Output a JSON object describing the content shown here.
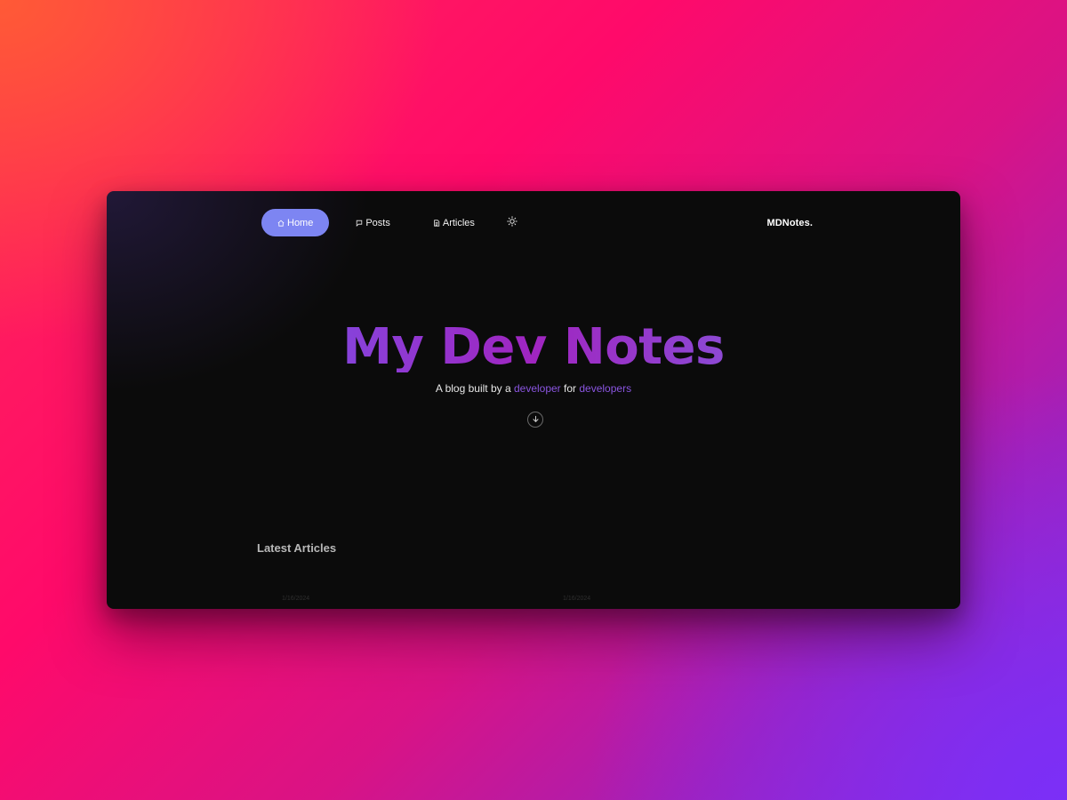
{
  "nav": {
    "items": [
      {
        "label": "Home",
        "icon": "home-icon",
        "active": true
      },
      {
        "label": "Posts",
        "icon": "chat-icon",
        "active": false
      },
      {
        "label": "Articles",
        "icon": "document-icon",
        "active": false
      }
    ],
    "theme_toggle_icon": "sun-icon",
    "brand": "MDNotes."
  },
  "hero": {
    "title": "My Dev Notes",
    "subtitle_parts": {
      "p1": "A blog built by a ",
      "p2": "developer",
      "p3": " for ",
      "p4": "developers"
    },
    "scroll_icon": "arrow-down-icon"
  },
  "latest": {
    "title": "Latest Articles",
    "cards": [
      {
        "date": "1/16/2024"
      },
      {
        "date": "1/16/2024"
      }
    ]
  },
  "colors": {
    "active_nav": "#7d85f2",
    "accent": "#8a55e0",
    "title_gradient_start": "#5b6cf5",
    "title_gradient_end": "#9b7ff0",
    "window_bg": "#0b0b0b"
  }
}
